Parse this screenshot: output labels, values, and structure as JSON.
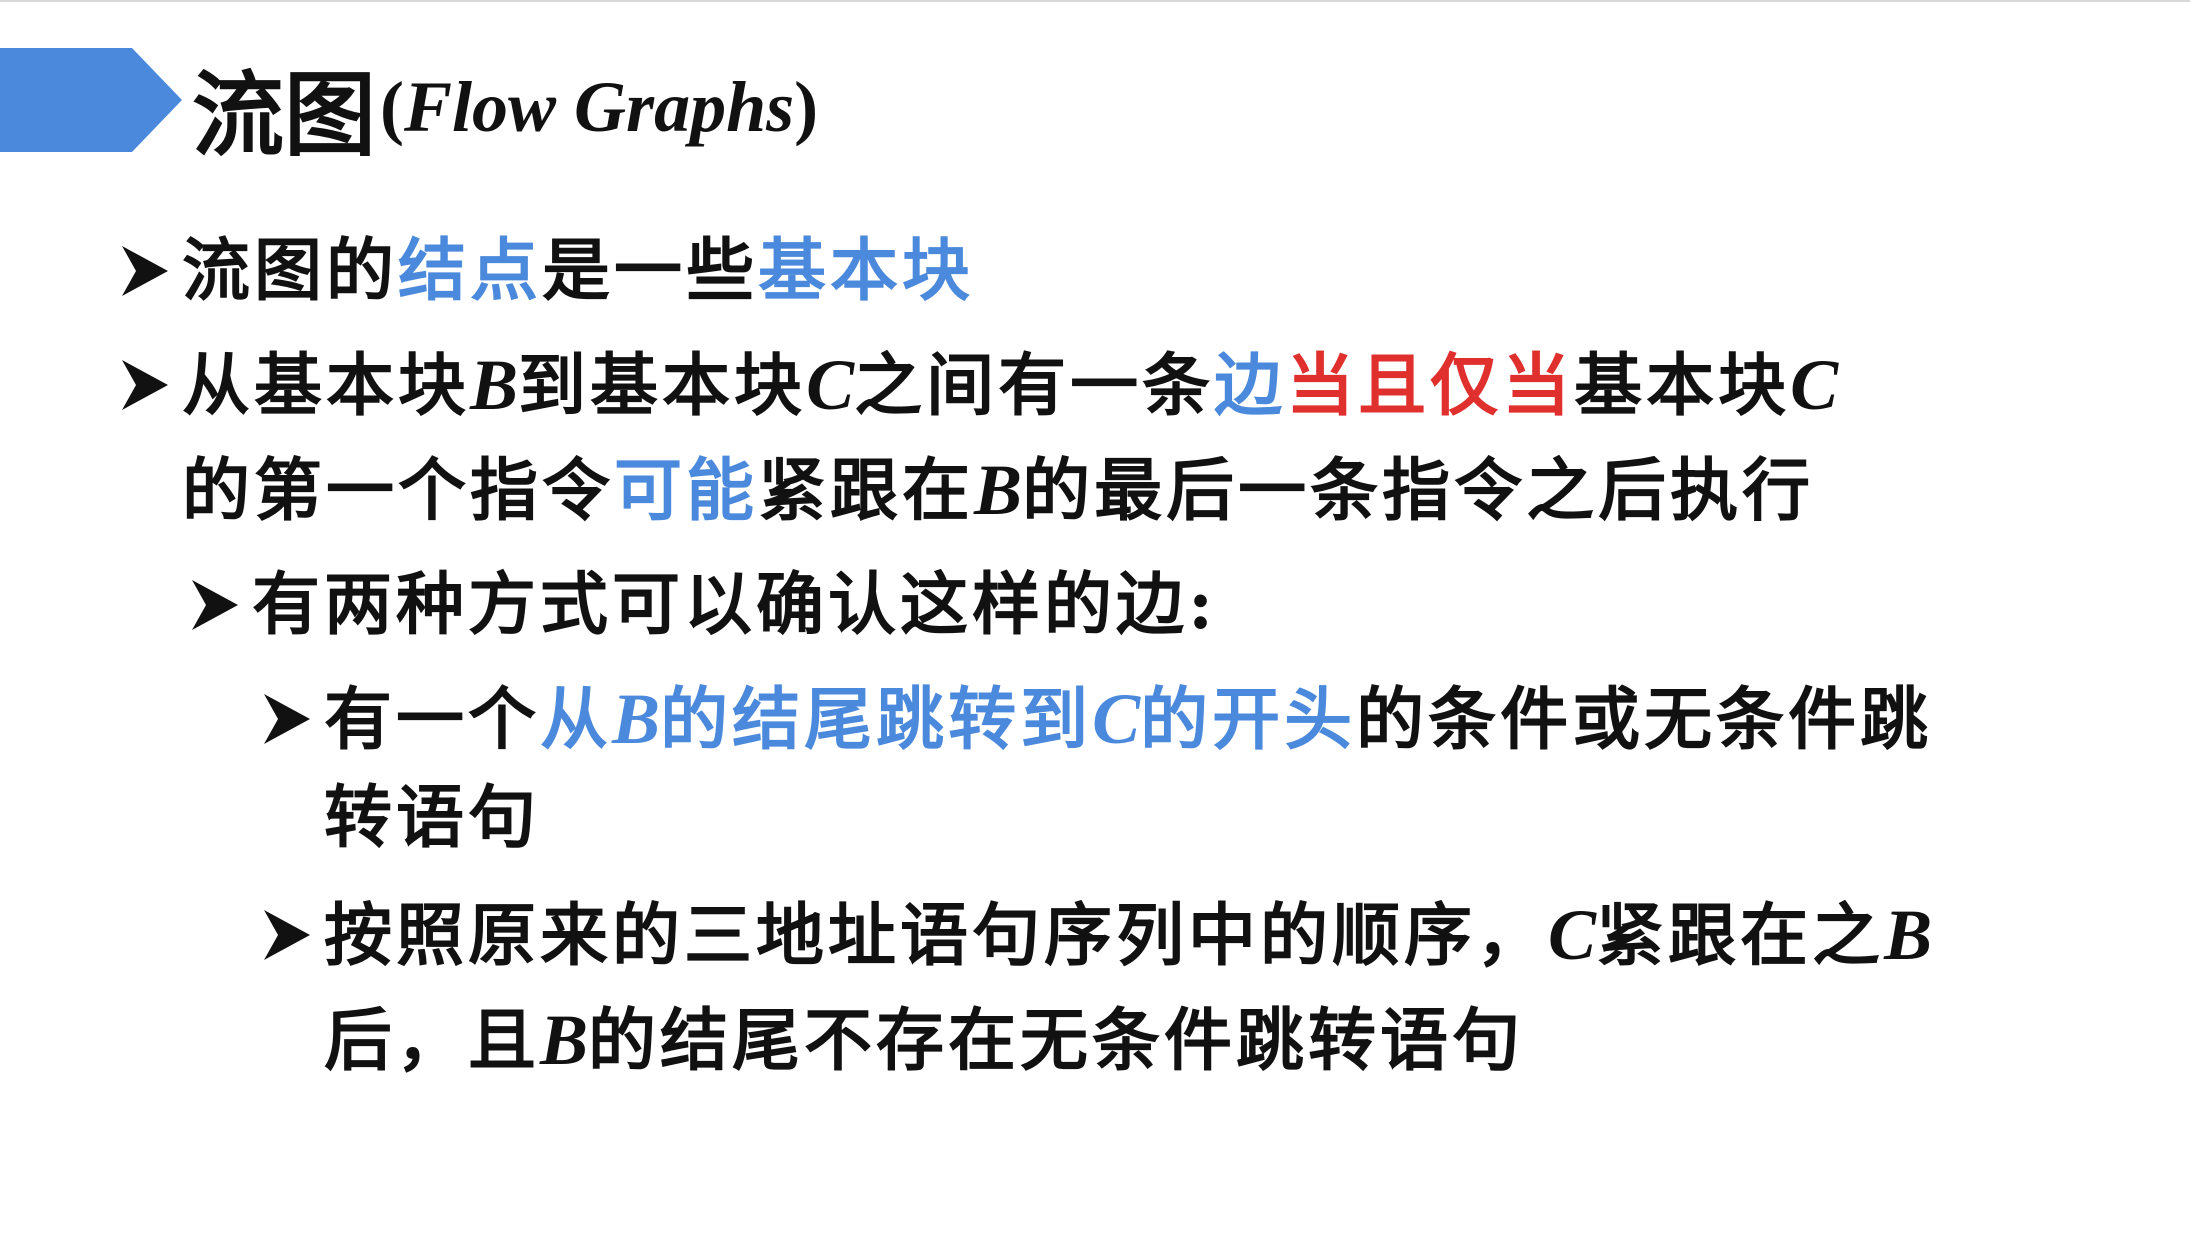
{
  "slide": {
    "title_zh": "流图",
    "title_en_open": "(",
    "title_en_italic": "Flow Graphs",
    "title_en_close": ")"
  },
  "colors": {
    "banner": "#4a89dc",
    "accent_blue": "#4a89dc",
    "accent_red": "#e0302e",
    "text": "#111111"
  },
  "bullets": {
    "b1": {
      "p1": "流图的",
      "p2": "结点",
      "p3": "是一些",
      "p4": "基本块"
    },
    "b2": {
      "p1": "从基本块",
      "p2": "B",
      "p3": "到基本块",
      "p4": "C",
      "p5": "之间有一条",
      "p6": "边",
      "p7": "当且仅当",
      "p8": "基本块",
      "p9": "C",
      "l2p1": "的第一个指令",
      "l2p2": "可能",
      "l2p3": "紧跟在",
      "l2p4": "B",
      "l2p5": "的最后一条指令之后执行"
    },
    "b3": {
      "p1": "有两种方式可以确认这样的边:"
    },
    "b4": {
      "p1": "有一个",
      "p2": "从",
      "p3": "B",
      "p4": "的结尾跳转到",
      "p5": "C",
      "p6": "的开头",
      "p7": "的条件或无条件跳",
      "l2p1": "转语句"
    },
    "b5": {
      "p1": "按照原来的三地址语句序列中的顺序，",
      "p2": "C",
      "p3": "紧跟在之",
      "p4": "B",
      "l2p1": "后，且",
      "l2p2": "B",
      "l2p3": "的结尾不存在无条件跳转语句"
    }
  },
  "icons": {
    "banner": "chevron-banner",
    "bullet": "arrowhead-bullet-icon"
  }
}
